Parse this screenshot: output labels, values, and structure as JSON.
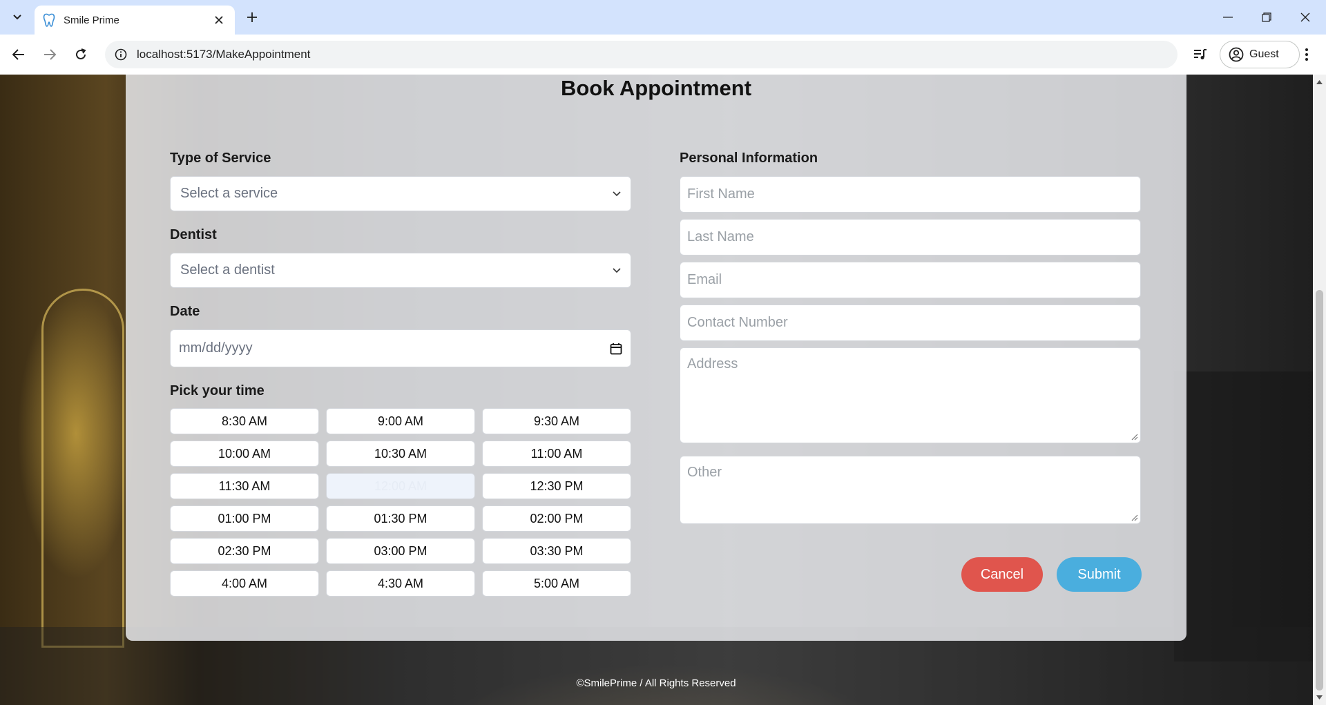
{
  "browser": {
    "tab_title": "Smile Prime",
    "url": "localhost:5173/MakeAppointment",
    "profile_label": "Guest"
  },
  "page": {
    "title": "Book Appointment",
    "service": {
      "label": "Type of Service",
      "placeholder": "Select a service"
    },
    "dentist": {
      "label": "Dentist",
      "placeholder": "Select a dentist"
    },
    "date": {
      "label": "Date",
      "placeholder": "mm/dd/yyyy"
    },
    "time": {
      "label": "Pick your time",
      "slots": [
        {
          "label": "8:30 AM",
          "disabled": false
        },
        {
          "label": "9:00 AM",
          "disabled": false
        },
        {
          "label": "9:30 AM",
          "disabled": false
        },
        {
          "label": "10:00 AM",
          "disabled": false
        },
        {
          "label": "10:30 AM",
          "disabled": false
        },
        {
          "label": "11:00 AM",
          "disabled": false
        },
        {
          "label": "11:30 AM",
          "disabled": false
        },
        {
          "label": "12:00 AM",
          "disabled": true
        },
        {
          "label": "12:30 PM",
          "disabled": false
        },
        {
          "label": "01:00 PM",
          "disabled": false
        },
        {
          "label": "01:30 PM",
          "disabled": false
        },
        {
          "label": "02:00 PM",
          "disabled": false
        },
        {
          "label": "02:30 PM",
          "disabled": false
        },
        {
          "label": "03:00 PM",
          "disabled": false
        },
        {
          "label": "03:30 PM",
          "disabled": false
        },
        {
          "label": "4:00 AM",
          "disabled": false
        },
        {
          "label": "4:30 AM",
          "disabled": false
        },
        {
          "label": "5:00 AM",
          "disabled": false
        }
      ]
    },
    "personal": {
      "label": "Personal Information",
      "first_name": "First Name",
      "last_name": "Last Name",
      "email": "Email",
      "contact": "Contact Number",
      "address": "Address",
      "other": "Other"
    },
    "buttons": {
      "cancel": "Cancel",
      "submit": "Submit"
    },
    "footer": "©SmilePrime / All Rights Reserved"
  },
  "colors": {
    "cancel": "#e0554d",
    "submit": "#4aaede",
    "tabbar": "#d3e3fd"
  }
}
